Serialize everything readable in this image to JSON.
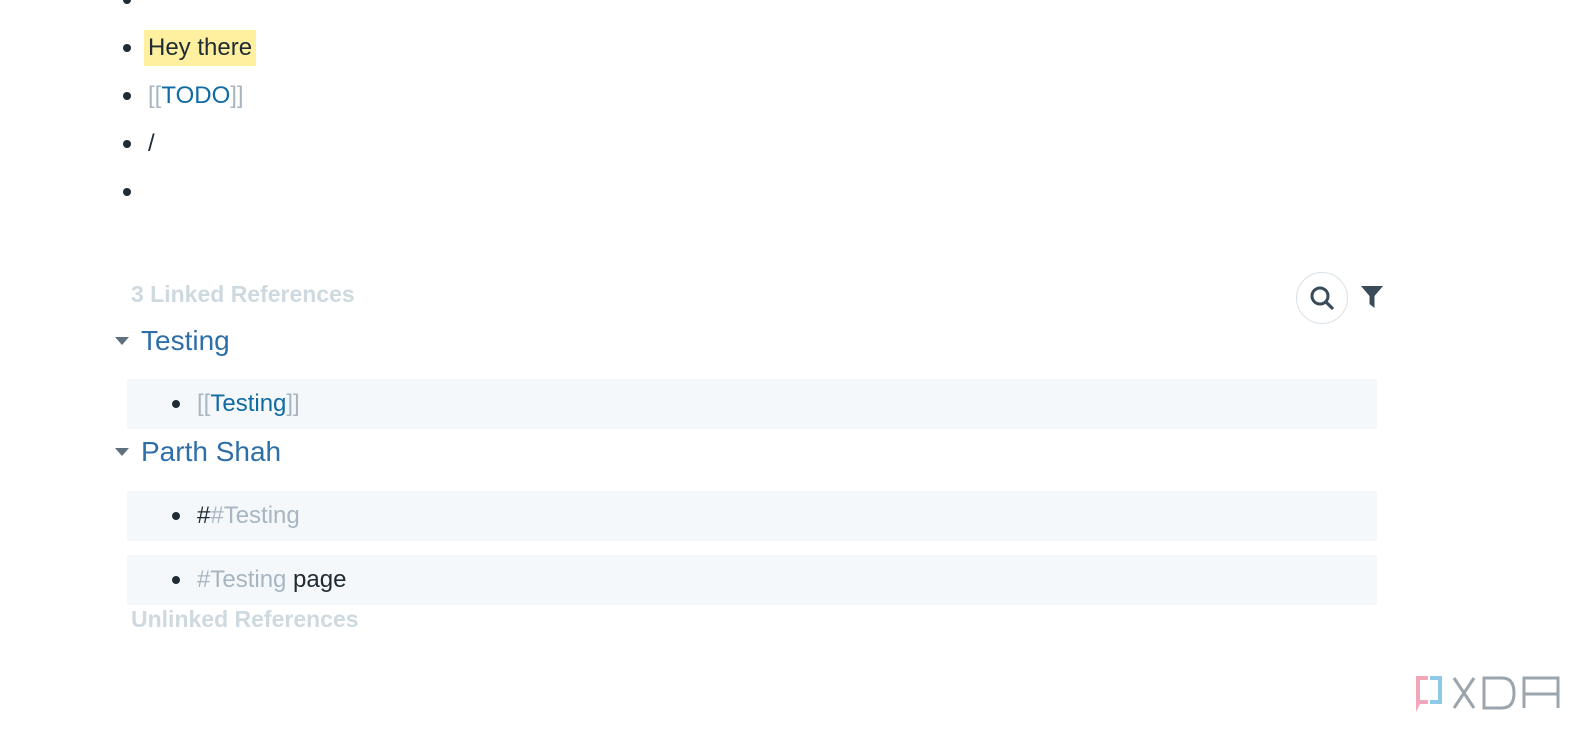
{
  "blocks": [
    {
      "text": ""
    },
    {
      "text": "Hey there"
    },
    {
      "bracket_open": "[[",
      "link": "TODO",
      "bracket_close": "]]"
    },
    {
      "text": "/"
    },
    {
      "text": ""
    }
  ],
  "linked_refs": {
    "title": "3 Linked References",
    "search_icon": "search-icon",
    "filter_icon": "filter-icon",
    "groups": [
      {
        "title": "Testing",
        "items": [
          {
            "bracket_open": "[[",
            "link": "Testing",
            "bracket_close": "]]"
          }
        ]
      },
      {
        "title": "Parth Shah",
        "items": [
          {
            "prefix": "#",
            "tag": "#Testing",
            "suffix": ""
          },
          {
            "prefix": "",
            "tag": "#Testing",
            "suffix": " page"
          }
        ]
      }
    ]
  },
  "unlinked_refs": {
    "title": "Unlinked References"
  },
  "watermark": {
    "text": "XDA"
  },
  "colors": {
    "highlight": "#fef09f",
    "link": "#106ba3",
    "group_title": "#2f6fa8",
    "muted": "#a7b6c2",
    "ref_bg": "#f5f8fa"
  }
}
